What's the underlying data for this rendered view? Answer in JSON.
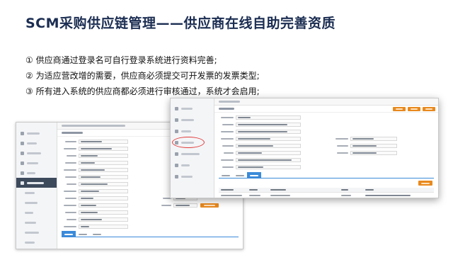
{
  "slide": {
    "title": "SCM采购供应链管理——供应商在线自助完善资质",
    "bullets": [
      "① 供应商通过登录名可自行登录系统进行资料完善;",
      "② 为适应营改增的需要，供应商必须提交可开发票的发票类型;",
      "③ 所有进入系统的供应商都必须进行审核通过，系统才会启用;"
    ]
  },
  "colors": {
    "title": "#1b2d52",
    "accent_orange": "#e8891e",
    "accent_blue": "#3b8ad9",
    "sidebar_active": "#3d4a5c",
    "highlight_circle": "#e23a3a"
  }
}
